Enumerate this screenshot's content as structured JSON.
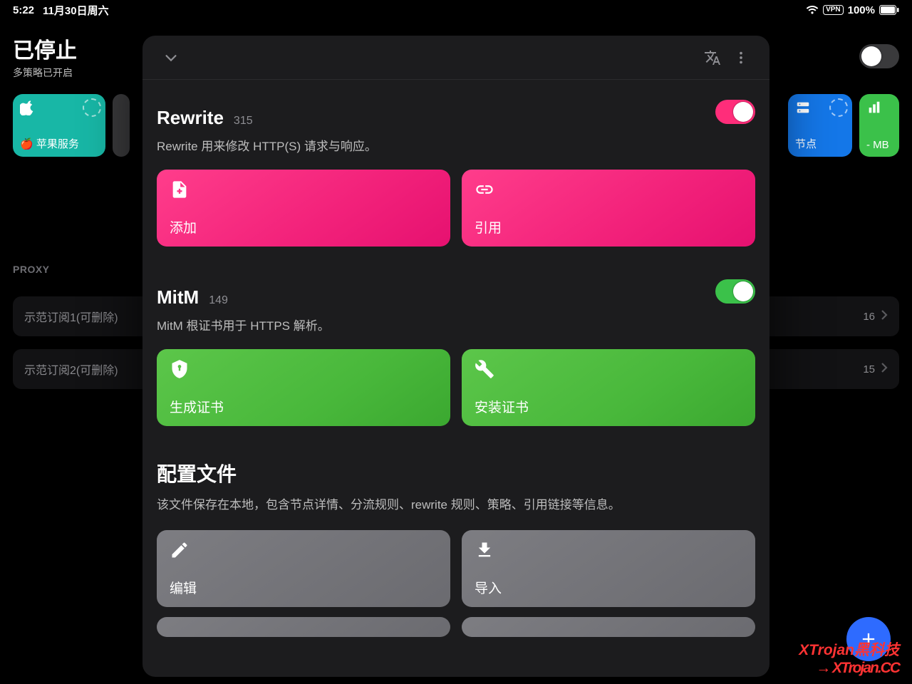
{
  "status": {
    "time": "5:22",
    "date": "11月30日周六",
    "vpn": "VPN",
    "battery": "100%"
  },
  "bg": {
    "title": "已停止",
    "subtitle": "多策略已开启",
    "tiles": {
      "apple": "🍎 苹果服务",
      "nodes": "节点",
      "stats": "- MB"
    },
    "proxy_label": "PROXY",
    "proxies": [
      {
        "name": "示范订阅1(可删除)",
        "count": "16"
      },
      {
        "name": "示范订阅2(可删除)",
        "count": "15"
      }
    ]
  },
  "modal": {
    "rewrite": {
      "title": "Rewrite",
      "count": "315",
      "desc": "Rewrite 用来修改 HTTP(S) 请求与响应。",
      "add": "添加",
      "ref": "引用"
    },
    "mitm": {
      "title": "MitM",
      "count": "149",
      "desc": "MitM 根证书用于 HTTPS 解析。",
      "gen": "生成证书",
      "install": "安装证书"
    },
    "config": {
      "title": "配置文件",
      "desc": "该文件保存在本地，包含节点详情、分流规则、rewrite 规则、策略、引用链接等信息。",
      "edit": "编辑",
      "import": "导入"
    }
  },
  "watermark": {
    "line1": "XTrojan黑科技",
    "line2": "→ XTrojan.CC"
  }
}
